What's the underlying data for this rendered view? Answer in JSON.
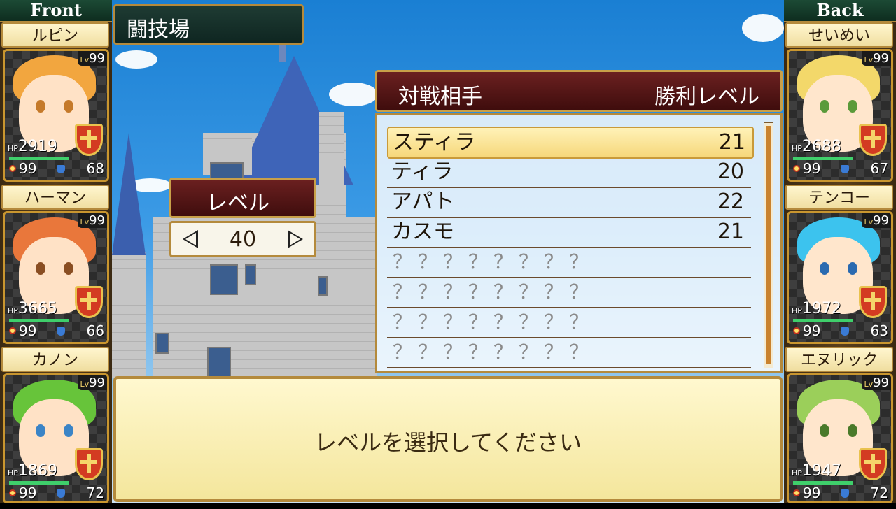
{
  "screen": {
    "title": "闘技場"
  },
  "front": {
    "header": "Front",
    "members": [
      {
        "name": "ルピン",
        "lv_label": "Lv",
        "lv": "99",
        "hp_label": "HP",
        "hp": "2919",
        "mp": "99",
        "tp": "68",
        "hair": "#f2a63f",
        "skin": "#ffe2c6",
        "eye": "#c57a2a"
      },
      {
        "name": "ハーマン",
        "lv_label": "Lv",
        "lv": "99",
        "hp_label": "HP",
        "hp": "3665",
        "mp": "99",
        "tp": "66",
        "hair": "#e9773b",
        "skin": "#ffe2c6",
        "eye": "#8a4e22"
      },
      {
        "name": "カノン",
        "lv_label": "Lv",
        "lv": "99",
        "hp_label": "HP",
        "hp": "1869",
        "mp": "99",
        "tp": "72",
        "hair": "#67c43a",
        "skin": "#ffe2c6",
        "eye": "#3b84c6"
      }
    ]
  },
  "back": {
    "header": "Back",
    "members": [
      {
        "name": "せいめい",
        "lv_label": "Lv",
        "lv": "99",
        "hp_label": "HP",
        "hp": "2688",
        "mp": "99",
        "tp": "67",
        "hair": "#f3d86a",
        "skin": "#ffe6cc",
        "eye": "#5a9a3a"
      },
      {
        "name": "テンコー",
        "lv_label": "Lv",
        "lv": "99",
        "hp_label": "HP",
        "hp": "1972",
        "mp": "99",
        "tp": "63",
        "hair": "#3cc3ee",
        "skin": "#ffe6cc",
        "eye": "#2a6ab0"
      },
      {
        "name": "エヌリック",
        "lv_label": "Lv",
        "lv": "99",
        "hp_label": "HP",
        "hp": "1947",
        "mp": "99",
        "tp": "72",
        "hair": "#9bcf5a",
        "skin": "#ffe6cc",
        "eye": "#4a7a2a"
      }
    ]
  },
  "level_selector": {
    "label": "レベル",
    "value": "40"
  },
  "opponents": {
    "header_left": "対戦相手",
    "header_right": "勝利レベル",
    "rows": [
      {
        "name": "スティラ",
        "level": "21",
        "selected": true
      },
      {
        "name": "ティラ",
        "level": "20"
      },
      {
        "name": "アパト",
        "level": "22"
      },
      {
        "name": "カスモ",
        "level": "21"
      },
      {
        "name": "？？？？？？？？",
        "level": ""
      },
      {
        "name": "？？？？？？？？",
        "level": ""
      },
      {
        "name": "？？？？？？？？",
        "level": ""
      },
      {
        "name": "？？？？？？？？",
        "level": ""
      }
    ]
  },
  "message": "レベルを選択してください"
}
